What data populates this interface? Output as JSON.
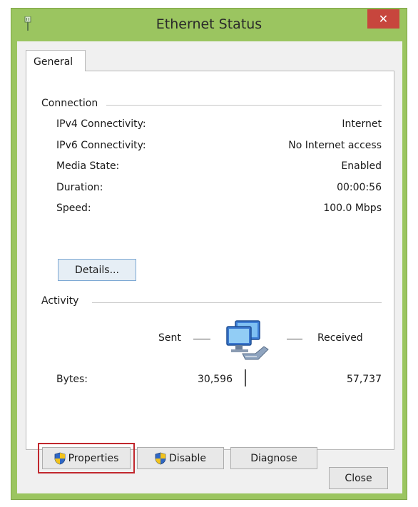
{
  "window": {
    "title": "Ethernet Status",
    "close_label": "✕"
  },
  "tabs": [
    {
      "label": "General",
      "selected": true
    }
  ],
  "connection": {
    "heading": "Connection",
    "rows": [
      {
        "label": "IPv4 Connectivity:",
        "value": "Internet"
      },
      {
        "label": "IPv6 Connectivity:",
        "value": "No Internet access"
      },
      {
        "label": "Media State:",
        "value": "Enabled"
      },
      {
        "label": "Duration:",
        "value": "00:00:56"
      },
      {
        "label": "Speed:",
        "value": "100.0 Mbps"
      }
    ],
    "details_button": "Details..."
  },
  "activity": {
    "heading": "Activity",
    "sent_label": "Sent",
    "received_label": "Received",
    "bytes_label": "Bytes:",
    "bytes_sent": "30,596",
    "bytes_received": "57,737",
    "icon": "network-computers-icon"
  },
  "actions": {
    "properties": "Properties",
    "disable": "Disable",
    "diagnose": "Diagnose",
    "close": "Close"
  },
  "colors": {
    "frame": "#9bc560",
    "close_button": "#c7463d",
    "highlight": "#c1272d",
    "shield_blue": "#2f67c4",
    "shield_yellow": "#f2c21b"
  }
}
